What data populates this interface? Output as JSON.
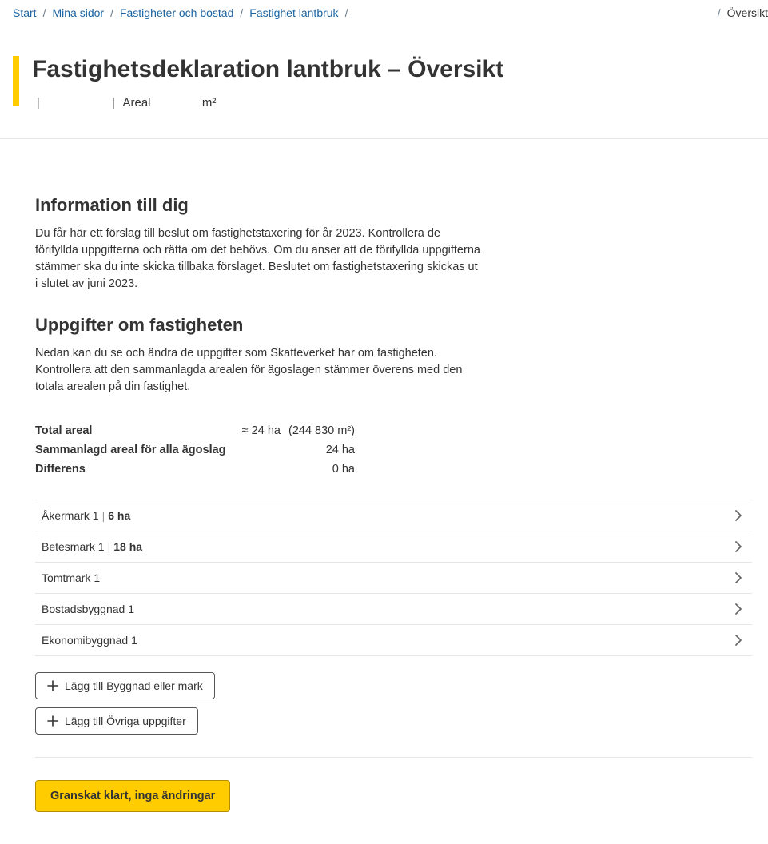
{
  "breadcrumb": {
    "items": [
      {
        "label": "Start"
      },
      {
        "label": "Mina sidor"
      },
      {
        "label": "Fastigheter och bostad"
      },
      {
        "label": "Fastighet lantbruk"
      }
    ],
    "current": "Översikt"
  },
  "title": "Fastighetsdeklaration lantbruk – Översikt",
  "subline": {
    "areal_label": "Areal",
    "areal_unit": "m²"
  },
  "info": {
    "heading": "Information till dig",
    "body": "Du får här ett förslag till beslut om fastighetstaxering för år 2023. Kontrollera de förifyllda uppgifterna och rätta om det behövs. Om du anser att de förifyllda uppgifterna stämmer ska du inte skicka tillbaka förslaget. Beslutet om fastighetstaxering skickas ut i slutet av juni 2023."
  },
  "uppgifter": {
    "heading": "Uppgifter om fastigheten",
    "body": "Nedan kan du se och ändra de uppgifter som Skatteverket har om fastigheten. Kontrollera att den sammanlagda arealen för ägoslagen stämmer överens med den totala arealen på din fastighet."
  },
  "areal": {
    "rows": [
      {
        "label": "Total areal",
        "value": "≈ 24 ha",
        "extra": "(244 830 m²)"
      },
      {
        "label": "Sammanlagd areal för alla ägoslag",
        "value": "24 ha",
        "extra": ""
      },
      {
        "label": "Differens",
        "value": "0 ha",
        "extra": ""
      }
    ]
  },
  "items": [
    {
      "name": "Åkermark 1",
      "detail": "6 ha"
    },
    {
      "name": "Betesmark 1",
      "detail": "18 ha"
    },
    {
      "name": "Tomtmark 1",
      "detail": ""
    },
    {
      "name": "Bostadsbyggnad 1",
      "detail": ""
    },
    {
      "name": "Ekonomibyggnad 1",
      "detail": ""
    }
  ],
  "buttons": {
    "add_building": "Lägg till Byggnad eller mark",
    "add_other": "Lägg till Övriga uppgifter",
    "done": "Granskat klart, inga ändringar"
  }
}
